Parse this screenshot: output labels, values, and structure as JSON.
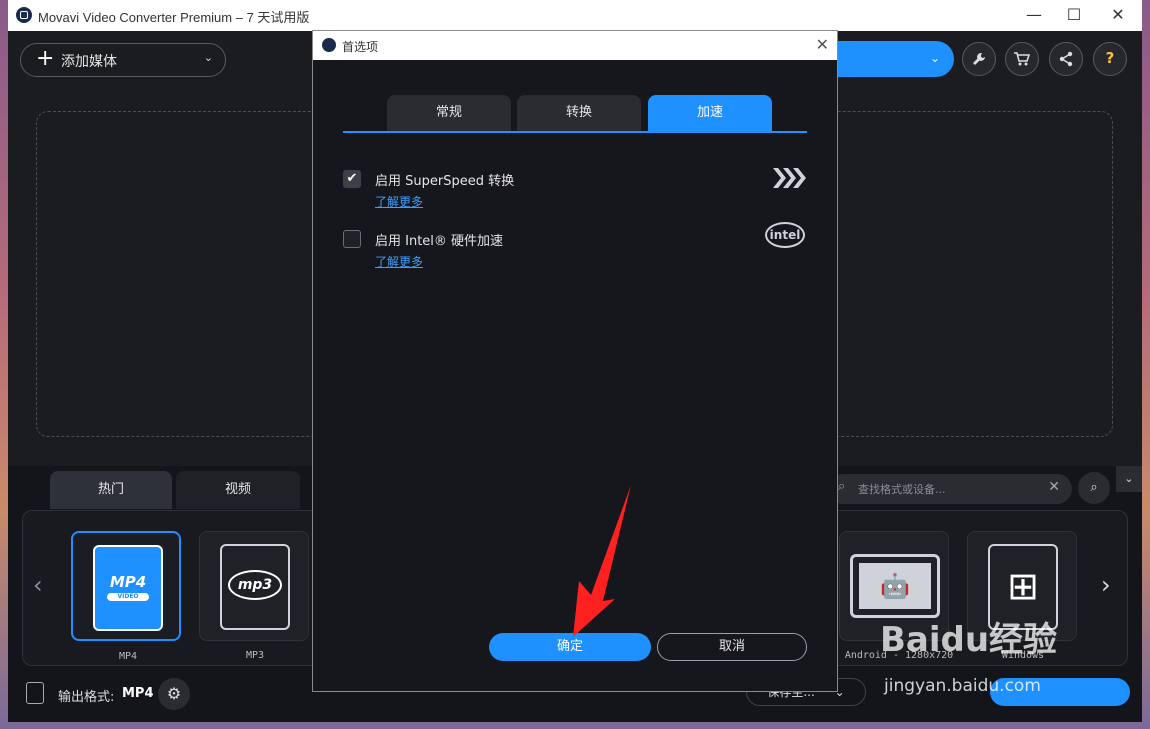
{
  "app": {
    "title": "Movavi Video Converter Premium – 7 天试用版",
    "minimize": "—",
    "maximize": "☐",
    "close": "✕"
  },
  "toolbar": {
    "add_media_label": "添加媒体",
    "add_media_plus": "+",
    "add_media_chevron": "⌄",
    "pill_chevron": "⌄",
    "wrench_glyph": "🔧",
    "cart_glyph": "🛒",
    "share_glyph": "⚲",
    "help_glyph": "?"
  },
  "format_tabs": [
    "热门",
    "视频"
  ],
  "search": {
    "placeholder": "查找格式或设备...",
    "icon_glyph": "⌕",
    "clear_glyph": "✕",
    "button_glyph": "⌕"
  },
  "collapse_glyph": "⌄",
  "nav": {
    "prev": "‹",
    "next": "›"
  },
  "format_cards": [
    {
      "label": "MP4",
      "badge": "MP4",
      "sub": "VIDEO",
      "selected": true
    },
    {
      "label": "MP3",
      "badge": "mp3",
      "selected": false
    },
    {
      "label": "Android - 1280x720",
      "glyph": "🤖",
      "selected": false
    },
    {
      "label": "Windows",
      "glyph": "⊞",
      "selected": false
    }
  ],
  "output": {
    "label": "输出格式:",
    "value": "MP4",
    "gear_glyph": "⚙",
    "save_label": "保存至...",
    "save_chevron": "⌄"
  },
  "dialog": {
    "title": "首选项",
    "close": "✕",
    "tabs": [
      {
        "label": "常规",
        "active": false
      },
      {
        "label": "转换",
        "active": false
      },
      {
        "label": "加速",
        "active": true
      }
    ],
    "options": [
      {
        "label": "启用 SuperSpeed 转换",
        "link": "了解更多",
        "checked": true,
        "check_glyph": "✔",
        "brand": "superspeed"
      },
      {
        "label": "启用 Intel® 硬件加速",
        "link": "了解更多",
        "checked": false,
        "brand": "intel"
      }
    ],
    "brand_intel_text": "intel",
    "ok_label": "确定",
    "cancel_label": "取消"
  },
  "watermark": {
    "logo": "Baidu经验",
    "url": "jingyan.baidu.com"
  },
  "colors": {
    "accent": "#1e90ff",
    "background": "#1b1c20",
    "arrow": "#ff2020"
  }
}
